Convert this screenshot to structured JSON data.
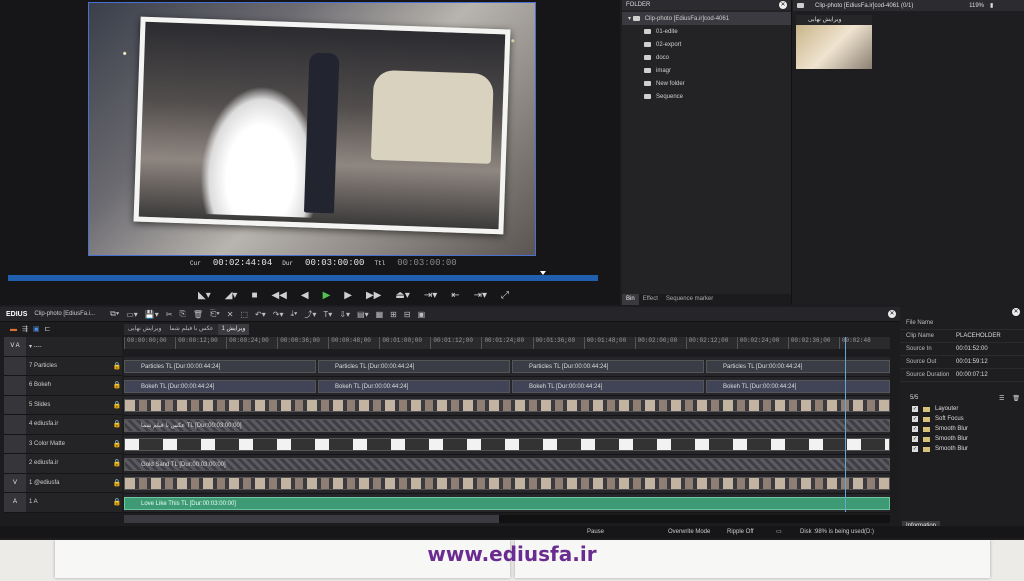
{
  "preview": {
    "cur_label": "Cur",
    "cur_value": "00:02:44:04",
    "dur_label": "Dur",
    "dur_value": "00:03:00:00",
    "ttl_label": "Ttl",
    "ttl_value": "00:03:00:00"
  },
  "transport": [
    "◣▾",
    "◢▾",
    "■",
    "◀◀",
    "◀",
    "▶",
    "▶",
    "▶▶",
    "⏏▾",
    "⇥▾",
    "⇤",
    "⇥▾",
    "⤢"
  ],
  "folder": {
    "title": "FOLDER",
    "root": "Clip-photo [EdiusFa.ir]cod-4061",
    "children": [
      "01-edite",
      "02-export",
      "doco",
      "imagr",
      "New folder",
      "Sequence"
    ],
    "tabs": [
      "Bin",
      "Effect",
      "Sequence marker"
    ]
  },
  "bin": {
    "path": "Clip-photo [EdiusFa.ir]cod-4061 (0/1)",
    "zoom": "119%",
    "item_name": "ویرایش نهایی"
  },
  "toolbar": {
    "brand": "EDIUS",
    "project": "Clip-photo [EdiusFa.i...",
    "icons": [
      "⧉▾",
      "▭▾",
      "💾▾",
      "✂",
      "⎘",
      "🗑",
      "⎗▾",
      "✕",
      "⬚",
      "↶▾",
      "↷▾",
      "⤓▾",
      "⤴▾",
      "T▾",
      "⇩▾",
      "▤▾",
      "▦",
      "⊞",
      "⊟",
      "▣"
    ]
  },
  "timeline": {
    "seq_tabs": [
      "ویرایش نهایی",
      "عکس با فیلم شما",
      "ویرایش 1"
    ],
    "ruler": [
      "00:00:00;00",
      "00:00:12;00",
      "00:00:24;00",
      "00:00:36;00",
      "00:00:48;00",
      "00:01:00;00",
      "00:01:12;00",
      "00:01:24;00",
      "00:01:36;00",
      "00:01:48;00",
      "00:02:00;00",
      "00:02:12;00",
      "00:02:24;00",
      "00:02:36;00",
      "00:02:48"
    ],
    "tracks": [
      {
        "name": "7 Particles",
        "type": "particles"
      },
      {
        "name": "6 Bokeh",
        "type": "bokeh"
      },
      {
        "name": "5 Slides",
        "type": "slides"
      },
      {
        "name": "4 ediusfa.ir",
        "type": "hatch",
        "clip": "عکس با فیلم شما  TL [Dur:00:03:00:00]"
      },
      {
        "name": "3 Color Matte",
        "type": "color"
      },
      {
        "name": "2 ediusfa.ir",
        "type": "hatch",
        "clip": "Gold Sand  TL [Dur:00:03:00:00]"
      },
      {
        "name": "1 @ediusfa",
        "type": "slides"
      },
      {
        "name": "1 A",
        "type": "audio",
        "clip": "Love Like This  TL [Dur:00:03:00:00]"
      }
    ],
    "particles_clip": "Particles  TL [Dur:00:00:44:24]",
    "bokeh_clip": "Bokeh  TL [Dur:00:00:44:24]"
  },
  "info": {
    "rows": [
      {
        "k": "File Name",
        "v": ""
      },
      {
        "k": "Clip Name",
        "v": "PLACEHOLDER"
      },
      {
        "k": "Source In",
        "v": "00:01:52:00"
      },
      {
        "k": "Source Out",
        "v": "00:01:59:12"
      },
      {
        "k": "Source Duration",
        "v": "00:00:07:12"
      }
    ],
    "fx_count": "5/5",
    "effects": [
      "Layouter",
      "Soft Focus",
      "Smooth Blur",
      "Smooth Blur",
      "Smooth Blur"
    ],
    "tab": "Information"
  },
  "status": {
    "pause": "Pause",
    "overwrite": "Overwrite Mode",
    "ripple": "Ripple Off",
    "disk": "Disk :98% is being used(D:)"
  },
  "watermark": "www.ediusfa.ir"
}
